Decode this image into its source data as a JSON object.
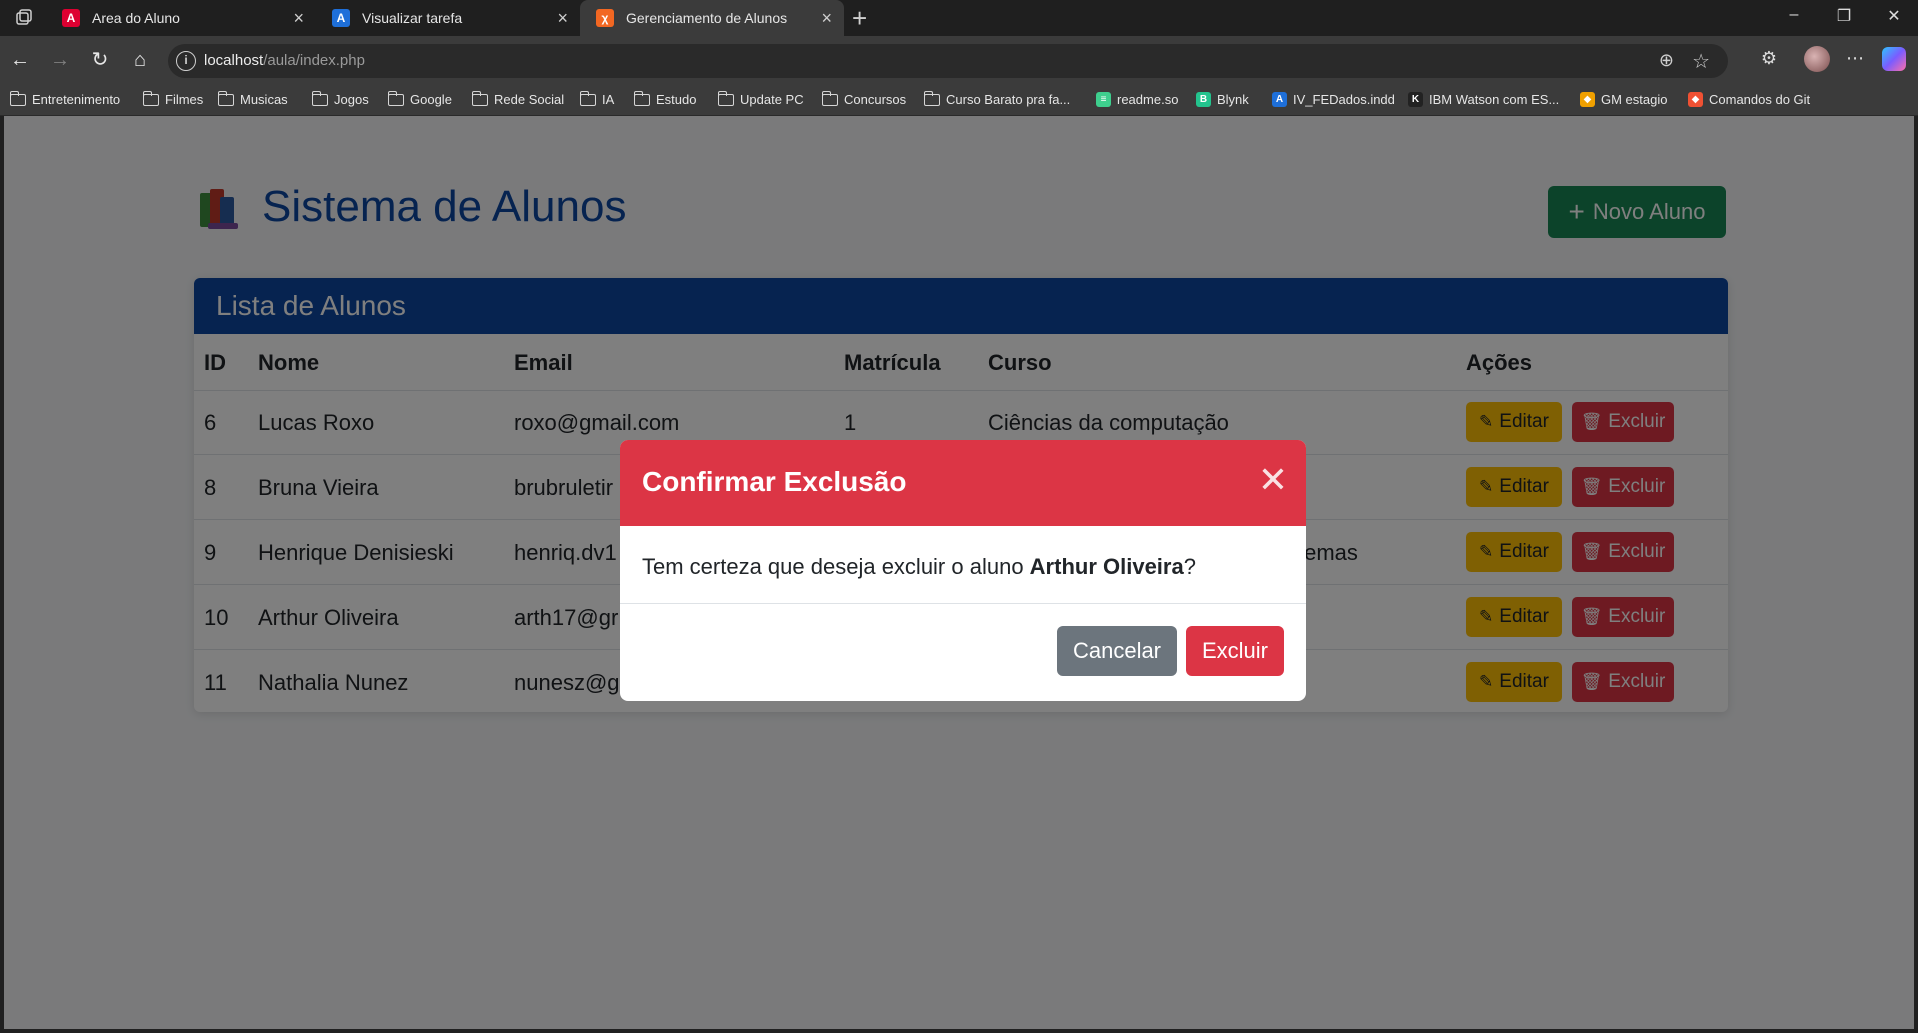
{
  "browser": {
    "tabs": [
      {
        "title": "Area do Aluno",
        "favicon": "angular-icon",
        "color": "#dd0031",
        "glyph": "A"
      },
      {
        "title": "Visualizar tarefa",
        "favicon": "app-icon",
        "color": "#1e6fd9",
        "glyph": "A"
      },
      {
        "title": "Gerenciamento de Alunos",
        "favicon": "xampp-icon",
        "color": "#f26722",
        "glyph": "χ",
        "active": true
      }
    ],
    "url_host": "localhost",
    "url_path": "/aula/index.php",
    "bookmarks": [
      {
        "label": "Entretenimento",
        "type": "folder"
      },
      {
        "label": "Filmes",
        "type": "folder"
      },
      {
        "label": "Musicas",
        "type": "folder"
      },
      {
        "label": "Jogos",
        "type": "folder"
      },
      {
        "label": "Google",
        "type": "folder"
      },
      {
        "label": "Rede Social",
        "type": "folder"
      },
      {
        "label": "IA",
        "type": "folder"
      },
      {
        "label": "Estudo",
        "type": "folder"
      },
      {
        "label": "Update PC",
        "type": "folder"
      },
      {
        "label": "Concursos",
        "type": "folder"
      },
      {
        "label": "Curso Barato pra fa...",
        "type": "folder"
      },
      {
        "label": "readme.so",
        "type": "site",
        "color": "#3ecf8e",
        "glyph": "≡"
      },
      {
        "label": "Blynk",
        "type": "site",
        "color": "#23c48e",
        "glyph": "B"
      },
      {
        "label": "IV_FEDados.indd",
        "type": "site",
        "color": "#1e6fd9",
        "glyph": "A"
      },
      {
        "label": "IBM Watson com ES...",
        "type": "site",
        "color": "#222222",
        "glyph": "K"
      },
      {
        "label": "GM estagio",
        "type": "site",
        "color": "#f0a000",
        "glyph": "◆"
      },
      {
        "label": "Comandos do Git",
        "type": "site",
        "color": "#f05133",
        "glyph": "◆"
      }
    ]
  },
  "app": {
    "title": "Sistema de Alunos",
    "new_button": "Novo Aluno",
    "card_title": "Lista de Alunos",
    "columns": [
      "ID",
      "Nome",
      "Email",
      "Matrícula",
      "Curso",
      "Ações"
    ],
    "rows": [
      {
        "id": "6",
        "nome": "Lucas Roxo",
        "email": "roxo@gmail.com",
        "matricula": "1",
        "curso": "Ciências da computação"
      },
      {
        "id": "8",
        "nome": "Bruna Vieira",
        "email": "brubruletir",
        "matricula": "",
        "curso": ""
      },
      {
        "id": "9",
        "nome": "Henrique Denisieski",
        "email": "henriq.dv1",
        "matricula": "",
        "curso": "temas"
      },
      {
        "id": "10",
        "nome": "Arthur Oliveira",
        "email": "arth17@gr",
        "matricula": "",
        "curso": ""
      },
      {
        "id": "11",
        "nome": "Nathalia Nunez",
        "email": "nunesz@g",
        "matricula": "",
        "curso": ""
      }
    ],
    "edit_label": "Editar",
    "delete_label": "Excluir",
    "colors": {
      "primary": "#0d47a1",
      "success": "#198754",
      "warning": "#ffc107",
      "danger": "#dc3545",
      "secondary": "#6c757d"
    }
  },
  "modal": {
    "title": "Confirmar Exclusão",
    "message_prefix": "Tem certeza que deseja excluir o aluno ",
    "student_name": "Arthur Oliveira",
    "message_suffix": "?",
    "cancel_label": "Cancelar",
    "confirm_label": "Excluir"
  }
}
